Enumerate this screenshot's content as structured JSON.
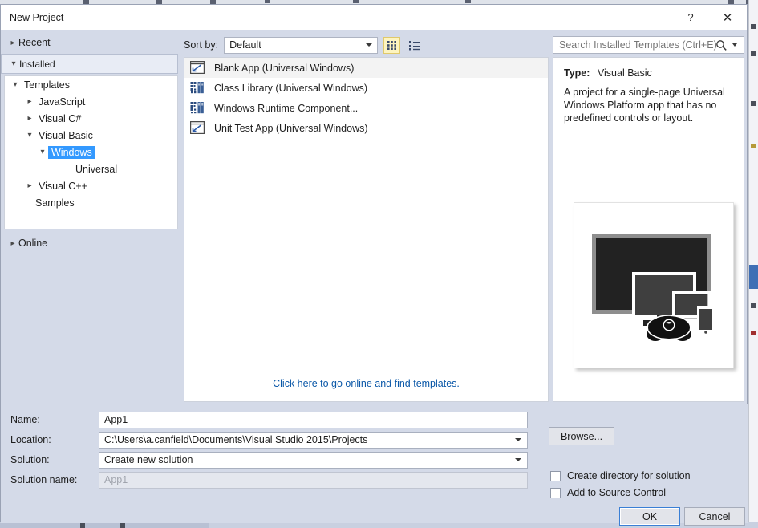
{
  "window": {
    "title": "New Project",
    "help_label": "?",
    "close_label": "✕"
  },
  "nav": {
    "recent": "Recent",
    "installed": "Installed",
    "online": "Online"
  },
  "tree": {
    "items": [
      {
        "label": "Templates",
        "indent": 0,
        "state": "expanded",
        "selected": false
      },
      {
        "label": "JavaScript",
        "indent": 1,
        "state": "collapsed",
        "selected": false
      },
      {
        "label": "Visual C#",
        "indent": 1,
        "state": "collapsed",
        "selected": false
      },
      {
        "label": "Visual Basic",
        "indent": 1,
        "state": "expanded",
        "selected": false
      },
      {
        "label": "Windows",
        "indent": 2,
        "state": "expanded",
        "selected": true
      },
      {
        "label": "Universal",
        "indent": 3,
        "state": "none",
        "selected": false
      },
      {
        "label": "Visual C++",
        "indent": 1,
        "state": "collapsed",
        "selected": false
      },
      {
        "label": "Samples",
        "indent": 0,
        "state": "none",
        "selected": false
      }
    ]
  },
  "toolbar": {
    "sort_label": "Sort by:",
    "sort_value": "Default",
    "grid_view_icon": "grid-view-icon",
    "list_view_icon": "list-view-icon"
  },
  "search": {
    "placeholder": "Search Installed Templates (Ctrl+E)",
    "icon": "search-icon"
  },
  "templates": {
    "items": [
      {
        "label": "Blank App (Universal Windows)",
        "icon": "app-window-icon",
        "selected": true
      },
      {
        "label": "Class Library (Universal Windows)",
        "icon": "class-library-icon",
        "selected": false
      },
      {
        "label": "Windows Runtime Component...",
        "icon": "class-library-icon",
        "selected": false
      },
      {
        "label": "Unit Test App (Universal Windows)",
        "icon": "app-window-icon",
        "selected": false
      }
    ],
    "online_link": "Click here to go online and find templates."
  },
  "preview": {
    "type_label": "Type:",
    "type_value": "Visual Basic",
    "description": "A project for a single-page Universal Windows Platform app that has no predefined controls or layout.",
    "illustration_name": "uwp-device-family-illustration"
  },
  "form": {
    "name_label": "Name:",
    "name_value": "App1",
    "location_label": "Location:",
    "location_value": "C:\\Users\\a.canfield\\Documents\\Visual Studio 2015\\Projects",
    "solution_label": "Solution:",
    "solution_value": "Create new solution",
    "solution_name_label": "Solution name:",
    "solution_name_value": "App1",
    "browse_label": "Browse...",
    "create_directory_label": "Create directory for solution",
    "source_control_label": "Add to Source Control",
    "ok_label": "OK",
    "cancel_label": "Cancel"
  },
  "colors": {
    "selection_blue": "#3399ff",
    "link_blue": "#0b58a8",
    "dialog_bg": "#d4dae8",
    "focus_blue": "#3a7fd5",
    "highlight_yellow": "#fdf4bf"
  }
}
